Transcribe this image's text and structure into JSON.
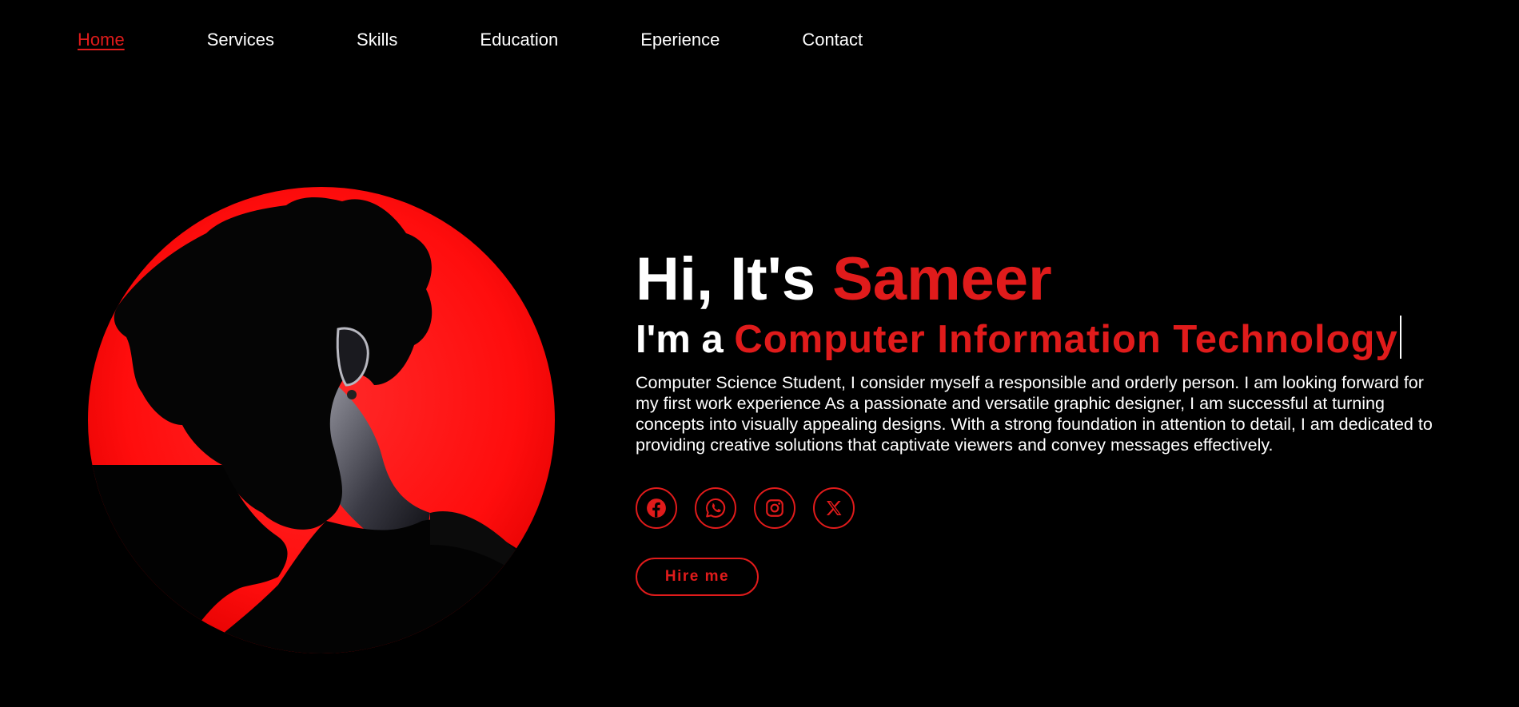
{
  "nav": {
    "items": [
      {
        "label": "Home",
        "active": true
      },
      {
        "label": "Services",
        "active": false
      },
      {
        "label": "Skills",
        "active": false
      },
      {
        "label": "Education",
        "active": false
      },
      {
        "label": "Eperience",
        "active": false
      },
      {
        "label": "Contact",
        "active": false
      }
    ]
  },
  "hero": {
    "greeting_prefix": "Hi, It's ",
    "name": "Sameer",
    "role_prefix": "I'm a ",
    "role": "Computer Information Technology",
    "bio": "Computer Science Student, I consider myself a responsible and orderly person. I am looking forward for my first work experience As a passionate and versatile graphic designer, I am successful at turning concepts into visually appealing designs. With a strong foundation in attention to detail, I am dedicated to providing creative solutions that captivate viewers and convey messages effectively.",
    "hire_label": "Hire me",
    "image_icon": "profile-silhouette-image"
  },
  "socials": [
    {
      "icon": "facebook-icon"
    },
    {
      "icon": "whatsapp-icon"
    },
    {
      "icon": "instagram-icon"
    },
    {
      "icon": "x-twitter-icon"
    }
  ],
  "colors": {
    "accent": "#e01b1b",
    "background": "#000000",
    "text": "#ffffff"
  }
}
